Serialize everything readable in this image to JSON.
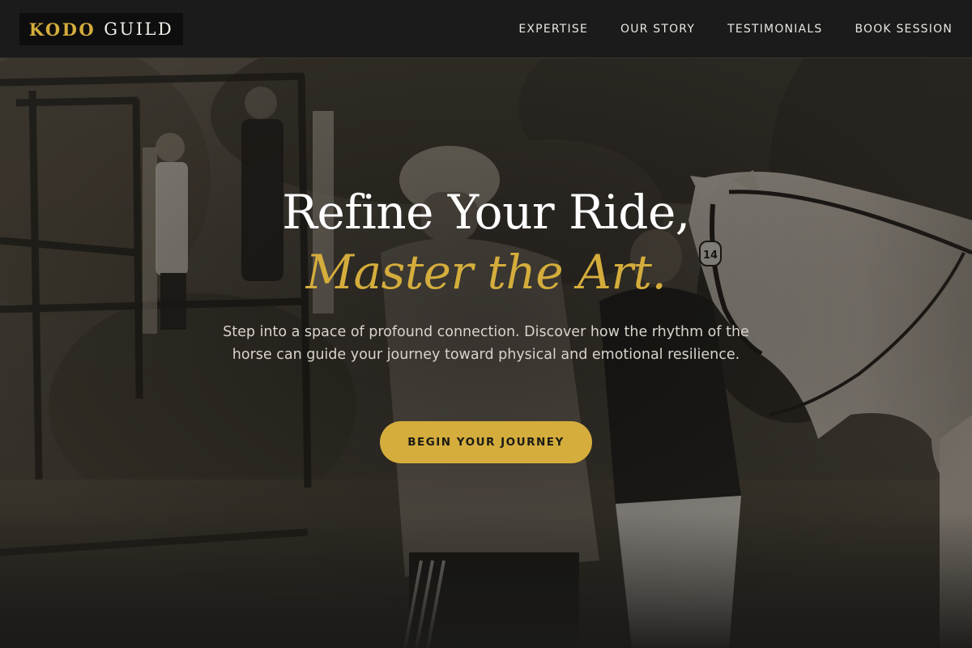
{
  "brand": {
    "word1": "KODO",
    "word2": "GUILD"
  },
  "nav": {
    "items": [
      {
        "label": "EXPERTISE"
      },
      {
        "label": "OUR STORY"
      },
      {
        "label": "TESTIMONIALS"
      },
      {
        "label": "BOOK SESSION"
      }
    ]
  },
  "hero": {
    "title_line1": "Refine Your Ride,",
    "title_line2": "Master the Art.",
    "description": "Step into a space of profound connection. Discover how the rhythm of the horse can guide your journey toward physical and emotional resilience.",
    "cta_label": "BEGIN YOUR JOURNEY",
    "bridle_number": "14"
  },
  "colors": {
    "accent": "#d4ad3c",
    "nav_background": "#1b1b1b",
    "logo_background": "#0e0e0e",
    "text_light": "#ffffff"
  }
}
